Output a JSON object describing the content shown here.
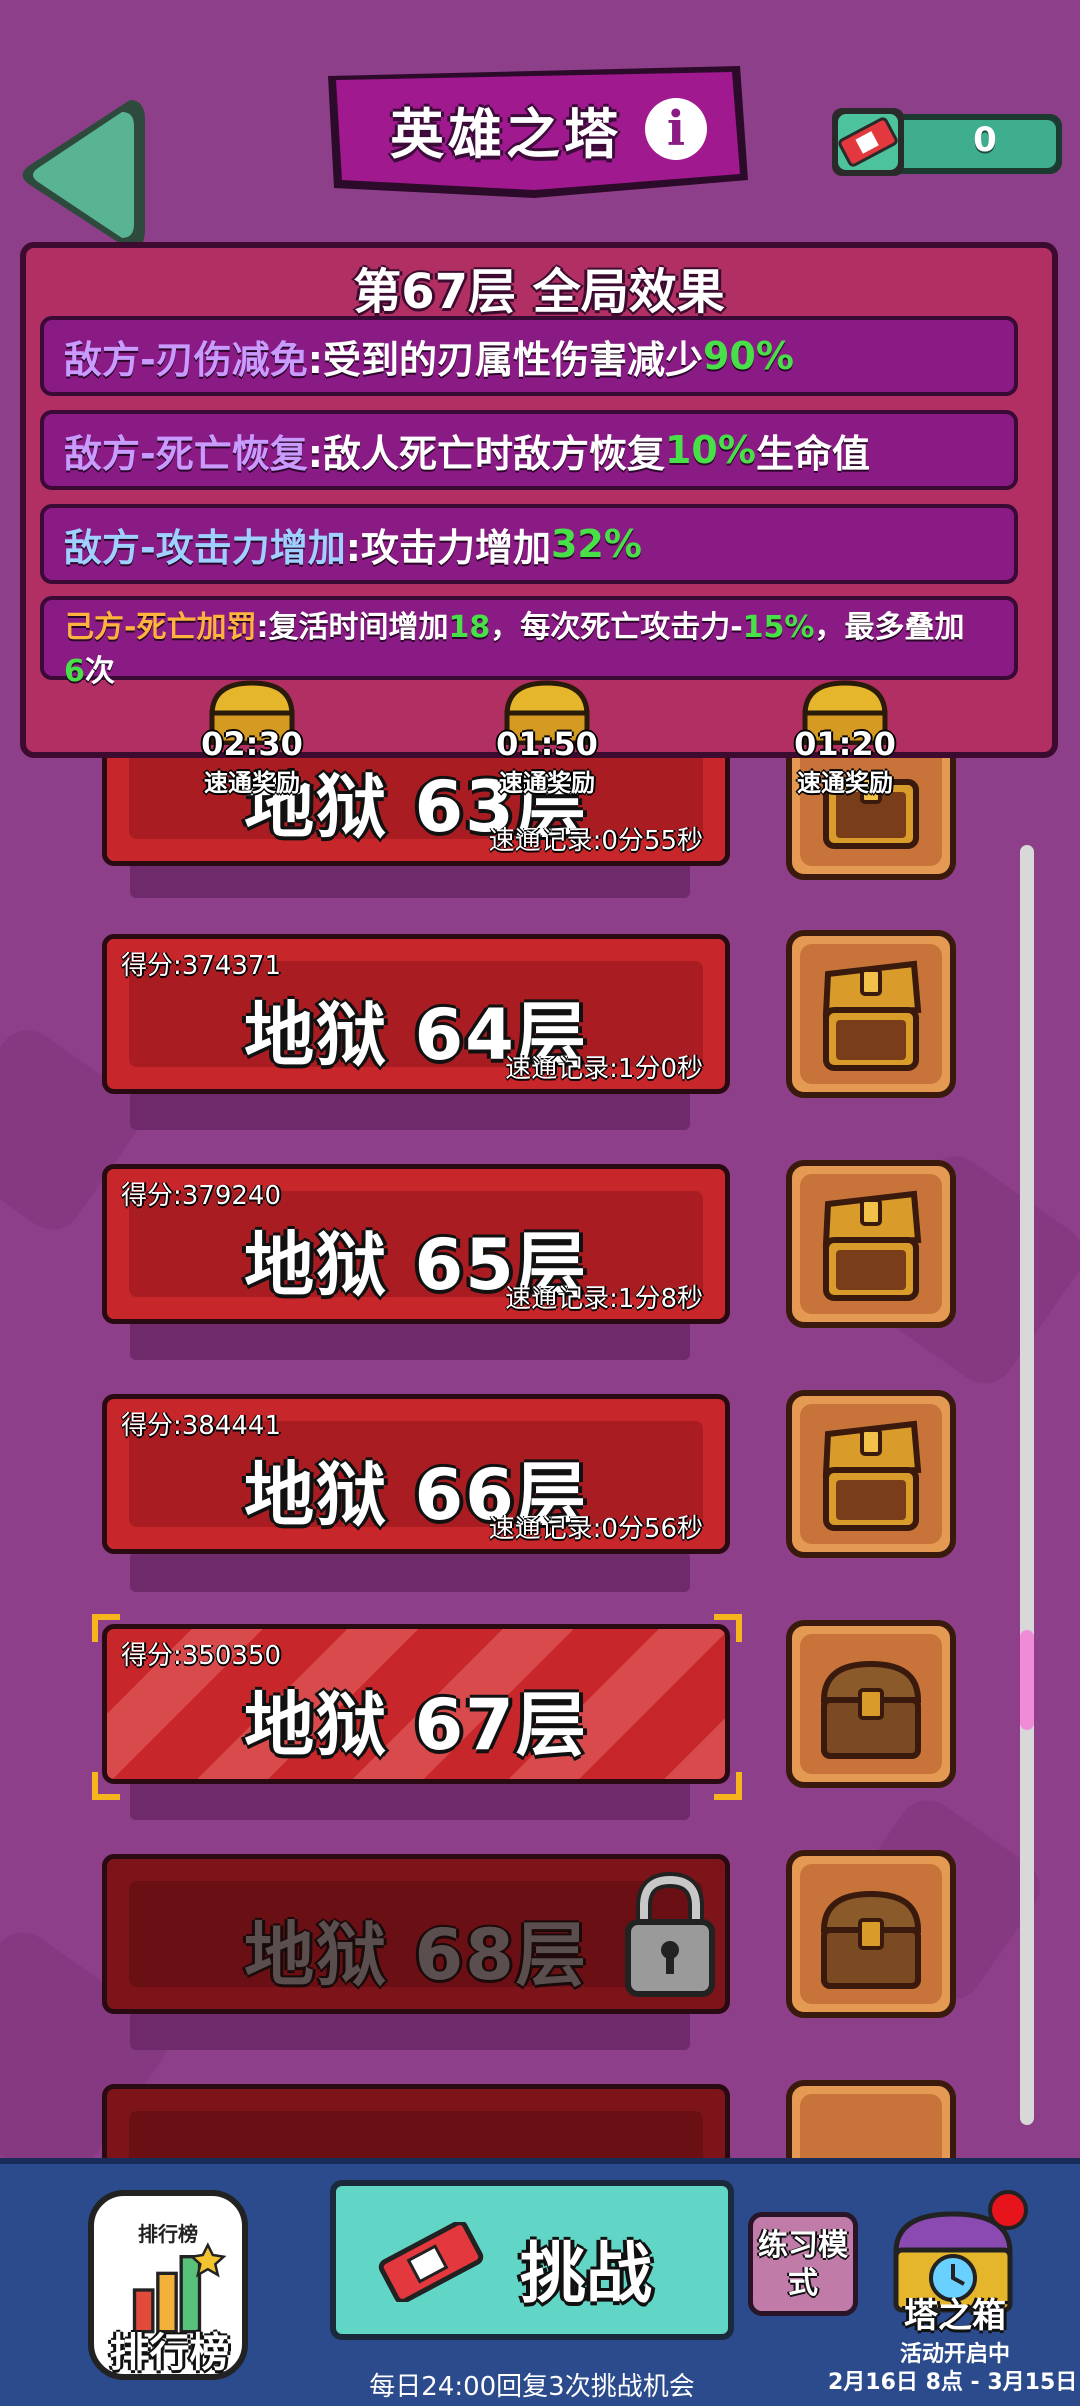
{
  "header": {
    "title": "英雄之塔",
    "ticket_count": "0"
  },
  "effects": {
    "title": "第67层 全局效果",
    "rows": [
      {
        "prefix": "敌方-刃伤减免",
        "text": ":受到的刃属性伤害减少",
        "value": "90%",
        "suffix": ""
      },
      {
        "prefix": "敌方-死亡恢复",
        "text": ":敌人死亡时敌方恢复",
        "value": "10%",
        "suffix": "生命值"
      },
      {
        "prefix": "敌方-攻击力增加",
        "text": ":攻击力增加",
        "value": "32%",
        "suffix": ""
      }
    ],
    "penalty": {
      "prefix": "己方-死亡加罚",
      "t1": ":复活时间增加",
      "v1": "18",
      "t2": "，每次死亡攻击力-",
      "v2": "15%",
      "t3": "，最多叠加",
      "v3": "6",
      "t4": "次"
    }
  },
  "rewards": [
    {
      "time": "02:30",
      "label": "速通奖励"
    },
    {
      "time": "01:50",
      "label": "速通奖励"
    },
    {
      "time": "01:20",
      "label": "速通奖励"
    }
  ],
  "floors": [
    {
      "name": "地狱 63层",
      "score": "",
      "record": "速通记录:0分55秒"
    },
    {
      "name": "地狱 64层",
      "score": "得分:374371",
      "record": "速通记录:1分0秒"
    },
    {
      "name": "地狱 65层",
      "score": "得分:379240",
      "record": "速通记录:1分8秒"
    },
    {
      "name": "地狱 66层",
      "score": "得分:384441",
      "record": "速通记录:0分56秒"
    },
    {
      "name": "地狱 67层",
      "score": "得分:350350",
      "record": ""
    },
    {
      "name": "地狱 68层",
      "score": "",
      "record": ""
    }
  ],
  "bottom": {
    "rank_small": "排行榜",
    "rank_label": "排行榜",
    "challenge_label": "挑战",
    "practice_label": "练习模式",
    "daily_text": "每日24:00回复3次挑战机会",
    "tower_label": "塔之箱",
    "event_status": "活动开启中",
    "event_date": "2月16日 8点 - 3月15日 0点"
  },
  "colors": {
    "background": "#8e3f8a",
    "panel": "#b12f62",
    "floor_red": "#c7262a",
    "green_value": "#48e048",
    "bottom_bar": "#2b4b8c",
    "challenge": "#61d6c6"
  }
}
